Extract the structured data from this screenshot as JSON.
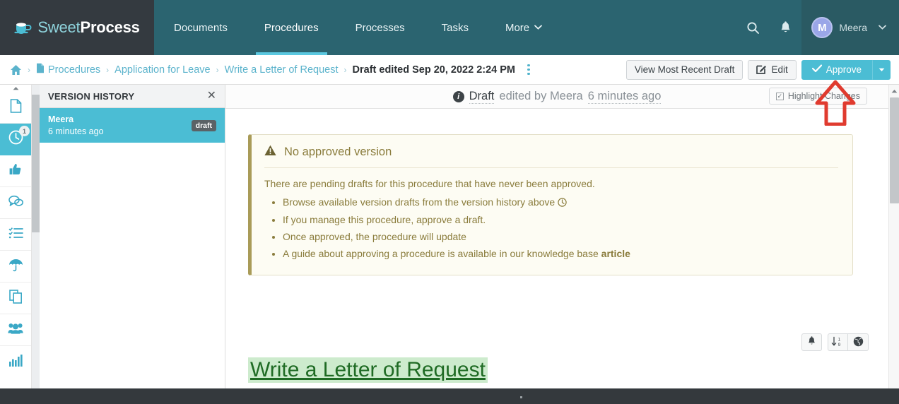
{
  "brand": {
    "name_light": "Sweet",
    "name_bold": "Process",
    "logo_icon": "coffee-cup-icon",
    "nav_bg": "#2b6470",
    "logo_bg": "#343a40",
    "accent": "#4bbdd4"
  },
  "nav": {
    "items": [
      {
        "label": "Documents",
        "active": false
      },
      {
        "label": "Procedures",
        "active": true
      },
      {
        "label": "Processes",
        "active": false
      },
      {
        "label": "Tasks",
        "active": false
      },
      {
        "label": "More",
        "active": false,
        "caret": "⌄"
      }
    ],
    "search_icon": "search-icon",
    "bell_icon": "bell-icon",
    "user": {
      "initial": "M",
      "name": "Meera",
      "caret": "⌄",
      "avatar_color": "#9aa6e8"
    }
  },
  "breadcrumb": {
    "home_icon": "home-icon",
    "doc_icon": "document-icon",
    "separator": "›",
    "items": [
      {
        "label": "Procedures",
        "current": false
      },
      {
        "label": "Application for Leave",
        "current": false
      },
      {
        "label": "Write a Letter of Request",
        "current": false
      },
      {
        "label": "Draft edited Sep 20, 2022 2:24 PM",
        "current": true
      }
    ],
    "kebab_icon": "more-options-icon"
  },
  "actions": {
    "view_recent_draft": "View Most Recent Draft",
    "edit": "Edit",
    "edit_icon": "pencil-square-icon",
    "approve": "Approve",
    "approve_icon": "check-icon",
    "approve_caret": "▼"
  },
  "rail": {
    "items": [
      {
        "icon": "document-icon",
        "name": "documents",
        "active": false
      },
      {
        "icon": "clock-icon",
        "name": "version-history",
        "active": true,
        "badge": "1"
      },
      {
        "icon": "thumbs-up-icon",
        "name": "approvals",
        "active": false
      },
      {
        "icon": "comments-icon",
        "name": "comments",
        "active": false
      },
      {
        "icon": "checklist-icon",
        "name": "tasks",
        "active": false
      },
      {
        "icon": "umbrella-icon",
        "name": "policies",
        "active": false
      },
      {
        "icon": "copy-icon",
        "name": "duplicate",
        "active": false
      },
      {
        "icon": "users-icon",
        "name": "teams",
        "active": false
      },
      {
        "icon": "bar-chart-icon",
        "name": "reports",
        "active": false
      }
    ]
  },
  "version_panel": {
    "title": "VERSION HISTORY",
    "close_icon": "close-icon",
    "rows": [
      {
        "author": "Meera",
        "time": "6 minutes ago",
        "badge": "draft",
        "selected": true
      }
    ]
  },
  "draft_bar": {
    "info_icon": "info-icon",
    "status": "Draft",
    "middle": " edited by Meera ",
    "time": "6 minutes ago",
    "highlight_changes": "Highlight Changes",
    "highlight_checked": true,
    "checkbox_icon": "checkbox-checked-icon"
  },
  "alert": {
    "warning_icon": "warning-triangle-icon",
    "title": "No approved version",
    "intro": "There are pending drafts for this procedure that have never been approved.",
    "bullets": [
      "Browse available version drafts from the version history above",
      "If you manage this procedure, approve a draft.",
      "Once approved, the procedure will update",
      "A guide about approving a procedure is available in our knowledge base"
    ],
    "bullet1_icon": "clock-icon",
    "bullet4_link": "article"
  },
  "float_buttons": [
    {
      "icon": "bell-icon",
      "name": "notify-button"
    },
    {
      "icon": "sort-numeric-icon",
      "name": "sort-button"
    },
    {
      "icon": "globe-icon",
      "name": "globe-button"
    }
  ],
  "document": {
    "title": "Write a Letter of Request",
    "highlight_color": "#cdebcd",
    "text_color": "#1f6b24"
  },
  "annotation": {
    "type": "red-up-arrow",
    "color": "#e03b2f",
    "points_at": "approve-button"
  }
}
